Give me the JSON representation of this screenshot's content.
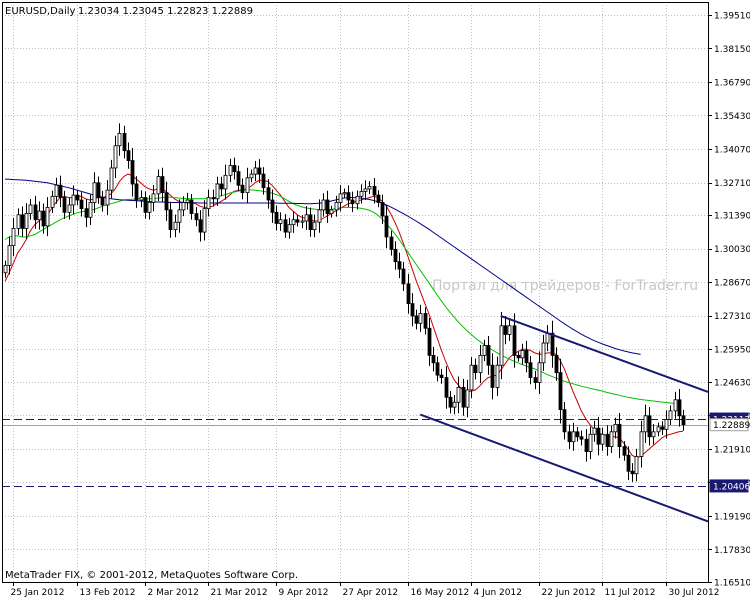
{
  "header": {
    "symbol": "EURUSD,Daily",
    "ohlc": "1.23034 1.23045 1.22823 1.22889"
  },
  "footer": {
    "copyright": "MetaTrader FIX, © 2001-2012, MetaQuotes Software Corp."
  },
  "watermark": "Портал для трейдеров - ForTrader.ru",
  "colors": {
    "background": "#ffffff",
    "frame": "#000000",
    "grid": "#c0c0c0",
    "candle": "#000000",
    "ma_fast": "#cc0000",
    "ma_medium": "#00c000",
    "ma_slow": "#00008b",
    "channel": "#191970",
    "hline": "#191970",
    "label_bg": "#191970",
    "label_text": "#ffffff",
    "watermark": "#c8c8c8"
  },
  "chart_data": {
    "type": "candlestick",
    "title": "EURUSD,Daily",
    "ylim": [
      1.1651,
      1.4003
    ],
    "y_ticks": [
      "1.39510",
      "1.38150",
      "1.36790",
      "1.35430",
      "1.34070",
      "1.32710",
      "1.31390",
      "1.30030",
      "1.28670",
      "1.27310",
      "1.25950",
      "1.24630",
      "1.23270",
      "1.21910",
      "1.20550",
      "1.19190",
      "1.17830",
      "1.16510"
    ],
    "x_ticks": [
      "25 Jan 2012",
      "13 Feb 2012",
      "2 Mar 2012",
      "21 Mar 2012",
      "9 Apr 2012",
      "27 Apr 2012",
      "16 May 2012",
      "4 Jun 2012",
      "22 Jun 2012",
      "11 Jul 2012",
      "30 Jul 2012"
    ],
    "grid": true,
    "price_labels": [
      {
        "text": "1.23117",
        "value": 1.23117
      },
      {
        "text": "1.22889",
        "value": 1.22889
      },
      {
        "text": "1.20406",
        "value": 1.20406
      }
    ],
    "horizontal_lines": [
      1.23117,
      1.20406
    ],
    "candles": {
      "close": [
        1.2935,
        1.3015,
        1.3085,
        1.314,
        1.3085,
        1.3145,
        1.318,
        1.312,
        1.3155,
        1.3095,
        1.317,
        1.3215,
        1.326,
        1.321,
        1.315,
        1.318,
        1.322,
        1.32,
        1.3165,
        1.313,
        1.319,
        1.327,
        1.321,
        1.318,
        1.324,
        1.333,
        1.342,
        1.347,
        1.34,
        1.336,
        1.3265,
        1.32,
        1.321,
        1.315,
        1.319,
        1.3225,
        1.3295,
        1.323,
        1.316,
        1.308,
        1.311,
        1.316,
        1.319,
        1.32,
        1.3145,
        1.312,
        1.307,
        1.3165,
        1.321,
        1.3205,
        1.3265,
        1.3245,
        1.33,
        1.334,
        1.3315,
        1.326,
        1.323,
        1.329,
        1.3305,
        1.333,
        1.3305,
        1.325,
        1.32,
        1.315,
        1.3105,
        1.312,
        1.307,
        1.31,
        1.312,
        1.311,
        1.3115,
        1.314,
        1.308,
        1.311,
        1.316,
        1.32,
        1.3145,
        1.316,
        1.319,
        1.3225,
        1.323,
        1.32,
        1.3185,
        1.3215,
        1.3235,
        1.3245,
        1.3255,
        1.322,
        1.319,
        1.3135,
        1.305,
        1.3,
        1.295,
        1.292,
        1.286,
        1.278,
        1.273,
        1.27,
        1.274,
        1.268,
        1.257,
        1.254,
        1.249,
        1.248,
        1.24,
        1.236,
        1.238,
        1.244,
        1.236,
        1.243,
        1.253,
        1.25,
        1.257,
        1.261,
        1.253,
        1.244,
        1.253,
        1.269,
        1.2655,
        1.269,
        1.257,
        1.256,
        1.259,
        1.254,
        1.248,
        1.246,
        1.254,
        1.262,
        1.266,
        1.257,
        1.25,
        1.235,
        1.226,
        1.222,
        1.226,
        1.224,
        1.223,
        1.218,
        1.225,
        1.2275,
        1.221,
        1.225,
        1.22,
        1.226,
        1.229,
        1.22,
        1.2165,
        1.21,
        1.209,
        1.216,
        1.226,
        1.2325,
        1.224,
        1.226,
        1.228,
        1.227,
        1.231,
        1.2345,
        1.239,
        1.2325,
        1.2289
      ]
    },
    "series": [
      {
        "values": [
          1.287,
          1.2905,
          1.2945,
          1.2985,
          1.301,
          1.304,
          1.3075,
          1.31,
          1.3115,
          1.313,
          1.314,
          1.3165,
          1.319,
          1.321,
          1.3215,
          1.321,
          1.321,
          1.3215,
          1.3215,
          1.3205,
          1.32,
          1.3205,
          1.321,
          1.321,
          1.3215,
          1.3225,
          1.3245,
          1.3275,
          1.3295,
          1.3305,
          1.33,
          1.3285,
          1.327,
          1.3255,
          1.3245,
          1.324,
          1.3245,
          1.3245,
          1.3235,
          1.322,
          1.3205,
          1.3195,
          1.319,
          1.319,
          1.319,
          1.3185,
          1.3175,
          1.317,
          1.317,
          1.3175,
          1.3185,
          1.3195,
          1.3205,
          1.322,
          1.3235,
          1.324,
          1.324,
          1.3245,
          1.3255,
          1.327,
          1.328,
          1.328,
          1.3275,
          1.326,
          1.324,
          1.322,
          1.3195,
          1.317,
          1.3155,
          1.314,
          1.313,
          1.3125,
          1.312,
          1.3115,
          1.3115,
          1.3125,
          1.3135,
          1.3145,
          1.3155,
          1.3165,
          1.3175,
          1.3185,
          1.319,
          1.3195,
          1.32,
          1.3205,
          1.321,
          1.3215,
          1.321,
          1.3195,
          1.3175,
          1.3145,
          1.311,
          1.307,
          1.3025,
          1.2975,
          1.2925,
          1.2875,
          1.283,
          1.2785,
          1.274,
          1.269,
          1.264,
          1.259,
          1.2545,
          1.2505,
          1.247,
          1.245,
          1.243,
          1.242,
          1.2425,
          1.243,
          1.2445,
          1.2465,
          1.248,
          1.2485,
          1.249,
          1.251,
          1.2535,
          1.256,
          1.2575,
          1.2585,
          1.2595,
          1.2595,
          1.259,
          1.258,
          1.2575,
          1.2575,
          1.258,
          1.258,
          1.2575,
          1.255,
          1.2515,
          1.247,
          1.2425,
          1.2385,
          1.2345,
          1.2315,
          1.229,
          1.227,
          1.2255,
          1.225,
          1.2245,
          1.224,
          1.224,
          1.2235,
          1.2215,
          1.219,
          1.2165,
          1.2155,
          1.216,
          1.2175,
          1.219,
          1.2205,
          1.222,
          1.2235,
          1.2245,
          1.225,
          1.2255,
          1.226,
          1.2262
        ]
      },
      {
        "values": [
          1.304,
          1.305,
          1.3055,
          1.3055,
          1.305,
          1.305,
          1.3055,
          1.306,
          1.307,
          1.308,
          1.309,
          1.31,
          1.311,
          1.312,
          1.3128,
          1.3135,
          1.3142,
          1.3148,
          1.3152,
          1.3155,
          1.3158,
          1.3162,
          1.3168,
          1.3175,
          1.318,
          1.3185,
          1.319,
          1.3195,
          1.32,
          1.3202,
          1.3203,
          1.3204,
          1.3205,
          1.3205,
          1.3205,
          1.3206,
          1.3207,
          1.321,
          1.3212,
          1.3212,
          1.321,
          1.3208,
          1.3206,
          1.3205,
          1.3205,
          1.3205,
          1.3205,
          1.3205,
          1.3206,
          1.3208,
          1.3212,
          1.3217,
          1.3222,
          1.3228,
          1.3232,
          1.3236,
          1.324,
          1.3242,
          1.3242,
          1.324,
          1.3238,
          1.3235,
          1.3232,
          1.3228,
          1.3222,
          1.3215,
          1.3205,
          1.3195,
          1.3185,
          1.3178,
          1.3172,
          1.3168,
          1.3165,
          1.3163,
          1.3161,
          1.316,
          1.316,
          1.3162,
          1.3165,
          1.3168,
          1.317,
          1.317,
          1.317,
          1.3169,
          1.3167,
          1.3163,
          1.3158,
          1.315,
          1.3138,
          1.3123,
          1.3105,
          1.3085,
          1.3063,
          1.304,
          1.3015,
          1.299,
          1.2965,
          1.294,
          1.2915,
          1.289,
          1.2865,
          1.284,
          1.2815,
          1.279,
          1.2767,
          1.2745,
          1.2725,
          1.2705,
          1.2688,
          1.267,
          1.2655,
          1.264,
          1.2627,
          1.2615,
          1.2603,
          1.2592,
          1.2582,
          1.2572,
          1.2563,
          1.2555,
          1.2547,
          1.254,
          1.2533,
          1.2527,
          1.2521,
          1.2515,
          1.2508,
          1.25,
          1.2492,
          1.2485,
          1.2478,
          1.2471,
          1.2465,
          1.246,
          1.2455,
          1.245,
          1.2445,
          1.2441,
          1.2437,
          1.2433,
          1.2429,
          1.2425,
          1.242,
          1.2416,
          1.2412,
          1.2408,
          1.2404,
          1.24,
          1.2397,
          1.2394,
          1.2391,
          1.2389,
          1.2387,
          1.2385,
          1.2383,
          1.2381,
          1.2379,
          1.2377,
          1.2375
        ]
      },
      {
        "values": [
          1.3285,
          1.3284,
          1.3283,
          1.3282,
          1.3281,
          1.328,
          1.3278,
          1.3276,
          1.3274,
          1.3272,
          1.327,
          1.3266,
          1.3262,
          1.3258,
          1.3254,
          1.325,
          1.3245,
          1.324,
          1.3235,
          1.323,
          1.3225,
          1.322,
          1.3216,
          1.3212,
          1.3208,
          1.3205,
          1.3203,
          1.3201,
          1.32,
          1.3199,
          1.3198,
          1.3197,
          1.3196,
          1.3195,
          1.3194,
          1.3193,
          1.3192,
          1.3192,
          1.3191,
          1.319,
          1.319,
          1.319,
          1.3189,
          1.3189,
          1.3189,
          1.3189,
          1.3188,
          1.3188,
          1.3188,
          1.3188,
          1.3188,
          1.3188,
          1.3188,
          1.3188,
          1.3188,
          1.3188,
          1.3188,
          1.3188,
          1.3188,
          1.3188,
          1.3188,
          1.3188,
          1.3188,
          1.3188,
          1.3188,
          1.3187,
          1.3187,
          1.3187,
          1.3187,
          1.3186,
          1.3186,
          1.3185,
          1.3185,
          1.3186,
          1.3187,
          1.3189,
          1.3192,
          1.3196,
          1.32,
          1.3204,
          1.3208,
          1.321,
          1.321,
          1.321,
          1.3208,
          1.3205,
          1.3202,
          1.3198,
          1.3193,
          1.3187,
          1.318,
          1.3172,
          1.3163,
          1.3154,
          1.3145,
          1.3135,
          1.3125,
          1.3115,
          1.3104,
          1.3093,
          1.3082,
          1.307,
          1.3058,
          1.3046,
          1.3034,
          1.3022,
          1.301,
          1.2998,
          1.2986,
          1.2974,
          1.2962,
          1.295,
          1.2938,
          1.2926,
          1.2914,
          1.2902,
          1.289,
          1.2878,
          1.2866,
          1.2854,
          1.2842,
          1.283,
          1.2818,
          1.2806,
          1.2794,
          1.2782,
          1.277,
          1.2758,
          1.2746,
          1.2734,
          1.2722,
          1.271,
          1.2698,
          1.2687,
          1.2676,
          1.2666,
          1.2656,
          1.2647,
          1.2638,
          1.263,
          1.2623,
          1.2616,
          1.261,
          1.2604,
          1.2598,
          1.2593,
          1.2588,
          1.2584,
          1.258,
          1.2577,
          1.2574
        ]
      }
    ],
    "channel": {
      "upper": {
        "from": [
          117,
          1.273
        ],
        "to": [
          163,
          1.244
        ]
      },
      "lower": {
        "from": [
          98,
          1.233
        ],
        "to": [
          163,
          1.1915
        ]
      }
    }
  }
}
